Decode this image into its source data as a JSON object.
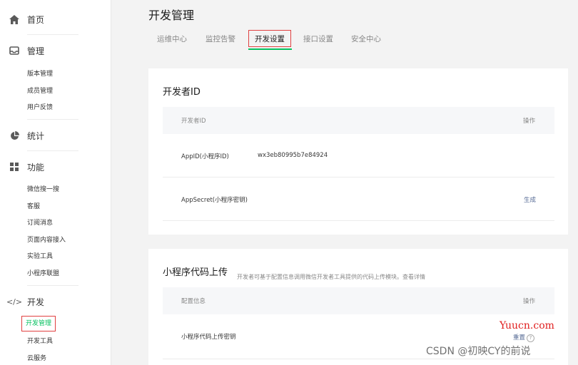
{
  "sidebar": {
    "home": {
      "label": "首页",
      "icon": "home-icon"
    },
    "manage": {
      "label": "管理",
      "icon": "inbox-icon",
      "items": [
        "版本管理",
        "成员管理",
        "用户反馈"
      ]
    },
    "stats": {
      "label": "统计",
      "icon": "pie-chart-icon"
    },
    "features": {
      "label": "功能",
      "icon": "grid-icon",
      "items": [
        "微信搜一搜",
        "客服",
        "订阅消息",
        "页面内容接入",
        "实验工具",
        "小程序联盟"
      ]
    },
    "develop": {
      "label": "开发",
      "icon": "code-icon",
      "items": [
        "开发管理",
        "开发工具",
        "云服务"
      ]
    }
  },
  "page": {
    "title": "开发管理"
  },
  "tabs": [
    "运维中心",
    "监控告警",
    "开发设置",
    "接口设置",
    "安全中心"
  ],
  "developer_id": {
    "title": "开发者ID",
    "col_id": "开发者ID",
    "col_action": "操作",
    "rows": [
      {
        "label": "AppID(小程序ID)",
        "value": "wx3eb80995b7e84924",
        "action": ""
      },
      {
        "label": "AppSecret(小程序密钥)",
        "value": "",
        "action": "生成"
      }
    ]
  },
  "upload": {
    "title": "小程序代码上传",
    "hint": "开发者可基于配置信息调用微信开发者工具提供的代码上传模块。",
    "hint_link": "查看详情",
    "col_config": "配置信息",
    "col_action": "操作",
    "rows": [
      {
        "label": "小程序代码上传密钥",
        "action": "重置"
      }
    ]
  },
  "watermarks": {
    "site": "Yuucn.com",
    "author": "CSDN @初映CY的前说"
  },
  "colors": {
    "accent": "#07c160",
    "highlight": "#e04040",
    "link": "#576b95"
  }
}
